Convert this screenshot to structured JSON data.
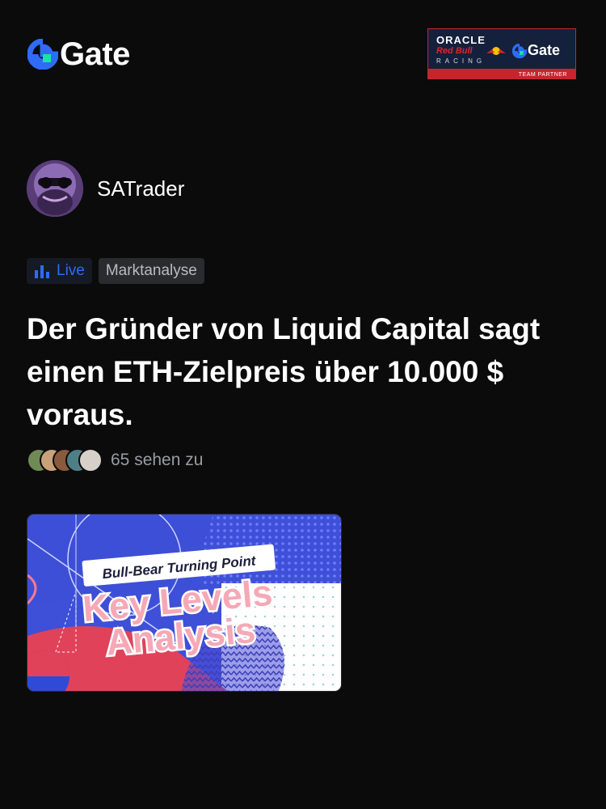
{
  "header": {
    "logo_text": "Gate",
    "partner": {
      "line1": "ORACLE",
      "line2": "Red Bull",
      "line3": "RACING",
      "brand": "Gate",
      "badge": "TEAM PARTNER"
    }
  },
  "author": {
    "name": "SATrader"
  },
  "tags": {
    "live_label": "Live",
    "topic_label": "Marktanalyse"
  },
  "post": {
    "title": "Der Gründer von Liquid Capital sagt einen ETH-Zielpreis über 10.000 $ voraus.",
    "viewers_text": "65 sehen zu"
  },
  "thumbnail": {
    "banner": "Bull-Bear Turning Point",
    "headline_line1": "Key Levels",
    "headline_line2": "Analysis"
  },
  "colors": {
    "background": "#0b0b0c",
    "brand_blue": "#2e6cf5",
    "brand_green": "#17e5a1",
    "partner_red": "#c4262b"
  },
  "icons": [
    "gate-logo-icon",
    "bar-chart-icon",
    "red-bull-icon"
  ]
}
